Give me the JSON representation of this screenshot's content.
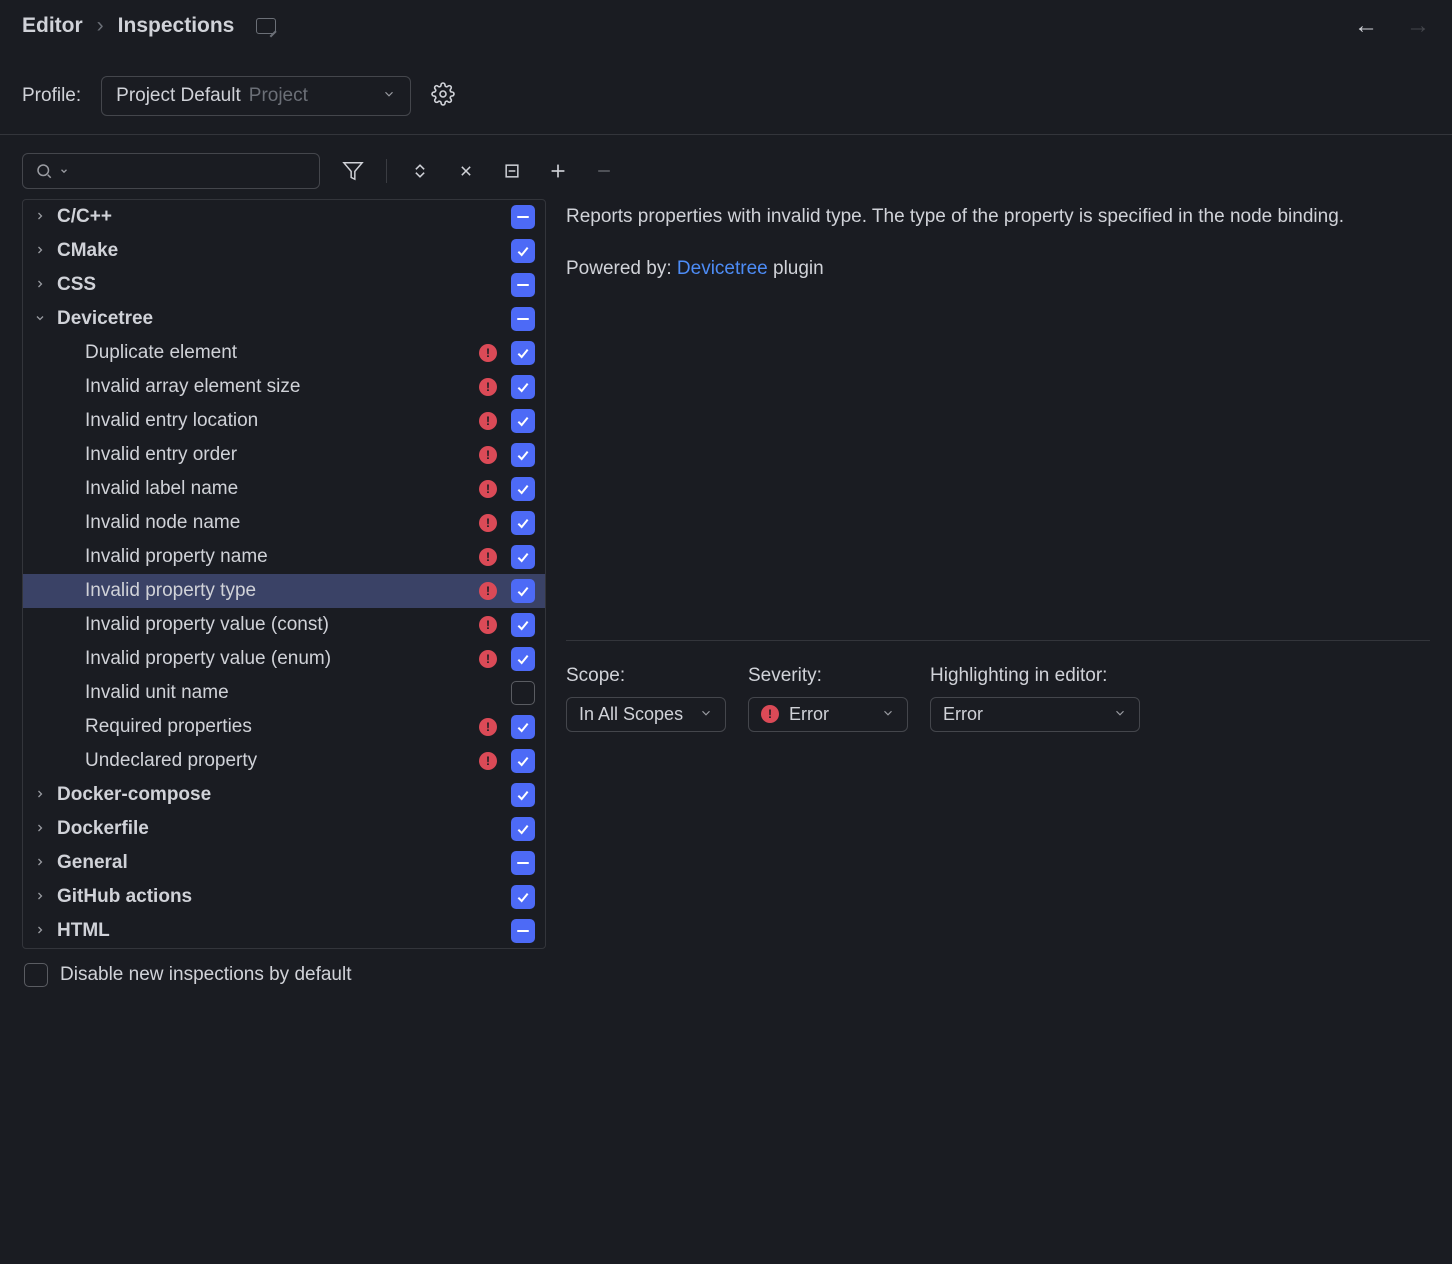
{
  "breadcrumb": {
    "root": "Editor",
    "current": "Inspections"
  },
  "profile": {
    "label": "Profile:",
    "name": "Project Default",
    "scope": "Project"
  },
  "footer": {
    "disable_new": "Disable new inspections by default"
  },
  "tree": {
    "items": [
      {
        "label": "C/C++",
        "bold": true,
        "expanded": false,
        "check": "mixed"
      },
      {
        "label": "CMake",
        "bold": true,
        "expanded": false,
        "check": "on"
      },
      {
        "label": "CSS",
        "bold": true,
        "expanded": false,
        "check": "mixed"
      },
      {
        "label": "Devicetree",
        "bold": true,
        "expanded": true,
        "check": "mixed"
      },
      {
        "label": "Duplicate element",
        "child": true,
        "err": true,
        "check": "on"
      },
      {
        "label": "Invalid array element size",
        "child": true,
        "err": true,
        "check": "on"
      },
      {
        "label": "Invalid entry location",
        "child": true,
        "err": true,
        "check": "on"
      },
      {
        "label": "Invalid entry order",
        "child": true,
        "err": true,
        "check": "on"
      },
      {
        "label": "Invalid label name",
        "child": true,
        "err": true,
        "check": "on"
      },
      {
        "label": "Invalid node name",
        "child": true,
        "err": true,
        "check": "on"
      },
      {
        "label": "Invalid property name",
        "child": true,
        "err": true,
        "check": "on"
      },
      {
        "label": "Invalid property type",
        "child": true,
        "err": true,
        "check": "on",
        "selected": true
      },
      {
        "label": "Invalid property value (const)",
        "child": true,
        "err": true,
        "check": "on"
      },
      {
        "label": "Invalid property value (enum)",
        "child": true,
        "err": true,
        "check": "on"
      },
      {
        "label": "Invalid unit name",
        "child": true,
        "err": false,
        "check": "off"
      },
      {
        "label": "Required properties",
        "child": true,
        "err": true,
        "check": "on"
      },
      {
        "label": "Undeclared property",
        "child": true,
        "err": true,
        "check": "on"
      },
      {
        "label": "Docker-compose",
        "bold": true,
        "expanded": false,
        "check": "on"
      },
      {
        "label": "Dockerfile",
        "bold": true,
        "expanded": false,
        "check": "on"
      },
      {
        "label": "General",
        "bold": true,
        "expanded": false,
        "check": "mixed"
      },
      {
        "label": "GitHub actions",
        "bold": true,
        "expanded": false,
        "check": "on"
      },
      {
        "label": "HTML",
        "bold": true,
        "expanded": false,
        "check": "mixed"
      }
    ]
  },
  "description": {
    "text": "Reports properties with invalid type. The type of the property is specified in the node binding.",
    "powered_label": "Powered by: ",
    "powered_link": "Devicetree",
    "powered_tail": " plugin"
  },
  "options": {
    "scope_label": "Scope:",
    "scope_value": "In All Scopes",
    "severity_label": "Severity:",
    "severity_value": "Error",
    "highlight_label": "Highlighting in editor:",
    "highlight_value": "Error"
  }
}
